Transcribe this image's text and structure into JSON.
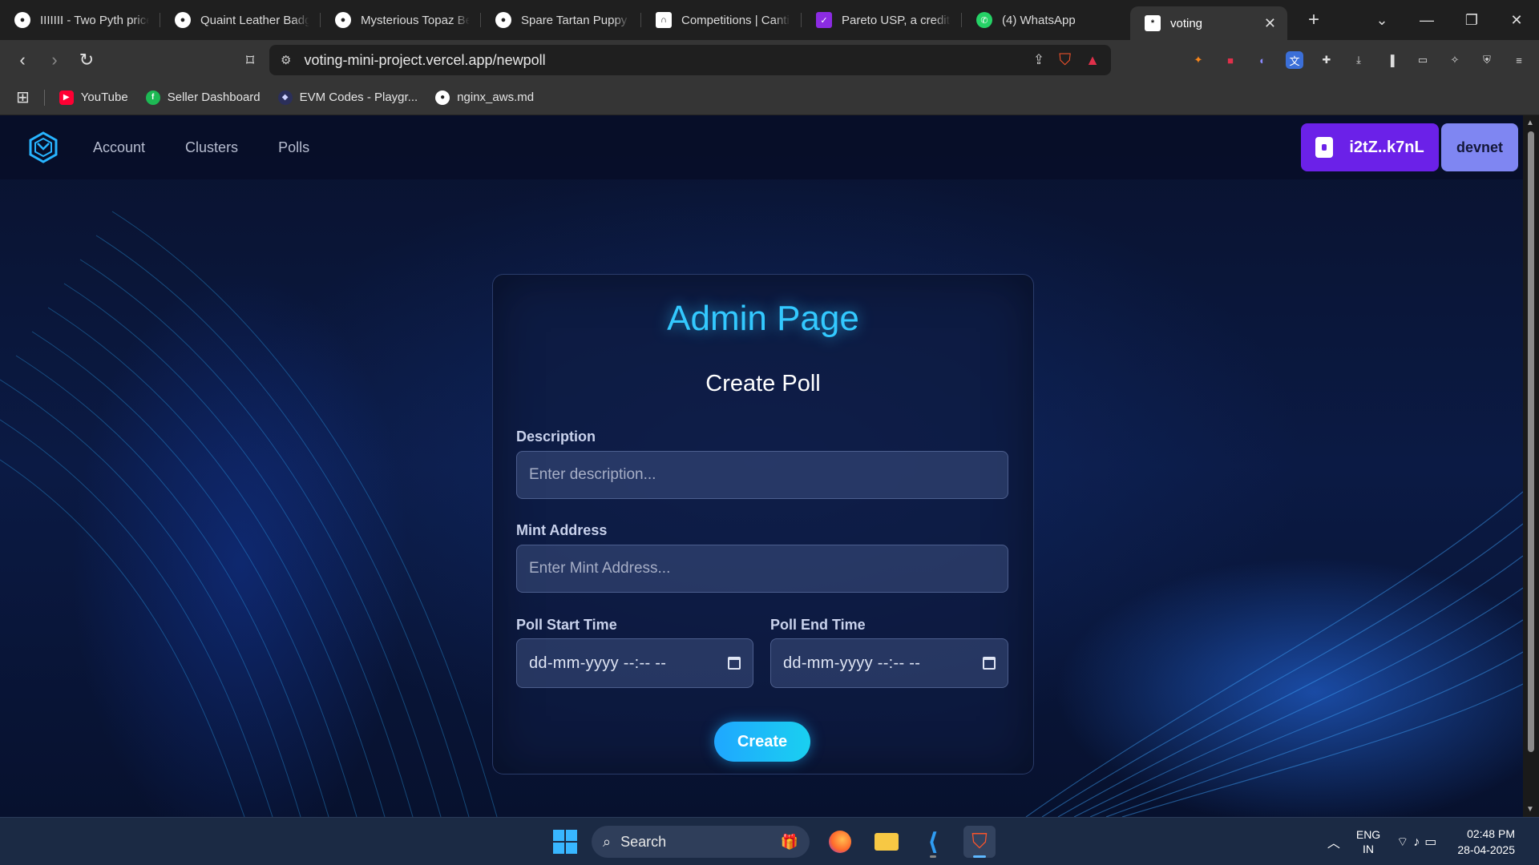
{
  "browser": {
    "tabs": [
      {
        "label": "IIIIIII - Two Pyth price",
        "icon": "github-icon"
      },
      {
        "label": "Quaint Leather Badge",
        "icon": "github-icon"
      },
      {
        "label": "Mysterious Topaz Bea",
        "icon": "github-icon"
      },
      {
        "label": "Spare Tartan Puppy -",
        "icon": "github-icon"
      },
      {
        "label": "Competitions | Cantina",
        "icon": "cantina-icon"
      },
      {
        "label": "Pareto USP, a credit-b",
        "icon": "pareto-icon"
      },
      {
        "label": "(4) WhatsApp",
        "icon": "whatsapp-icon"
      }
    ],
    "active_tab": {
      "label": "voting",
      "icon": "asterisk-icon"
    },
    "url": "voting-mini-project.vercel.app/newpoll",
    "bookmarks": [
      {
        "label": "YouTube",
        "icon": "youtube-icon",
        "color": "#ff0033"
      },
      {
        "label": "Seller Dashboard",
        "icon": "seller-icon",
        "color": "#1db954"
      },
      {
        "label": "EVM Codes - Playgr...",
        "icon": "ethereum-icon",
        "color": "#2b2f5a"
      },
      {
        "label": "nginx_aws.md",
        "icon": "github-icon",
        "color": "#ffffff"
      }
    ]
  },
  "app": {
    "nav": {
      "links": [
        "Account",
        "Clusters",
        "Polls"
      ],
      "wallet_label": "i2tZ..k7nL",
      "network_label": "devnet"
    },
    "card": {
      "title": "Admin Page",
      "subtitle": "Create Poll",
      "description_label": "Description",
      "description_placeholder": "Enter description...",
      "mint_label": "Mint Address",
      "mint_placeholder": "Enter Mint Address...",
      "start_label": "Poll Start Time",
      "end_label": "Poll End Time",
      "datetime_placeholder": "dd-mm-yyyy --:-- --",
      "create_label": "Create"
    }
  },
  "taskbar": {
    "search_label": "Search",
    "lang_1": "ENG",
    "lang_2": "IN",
    "time": "02:48 PM",
    "date": "28-04-2025"
  },
  "colors": {
    "accent_title": "#33c9ff",
    "wallet_purple": "#6b21e8",
    "network_lavender": "#7f86f2",
    "create_button": "#1fa7ff"
  }
}
